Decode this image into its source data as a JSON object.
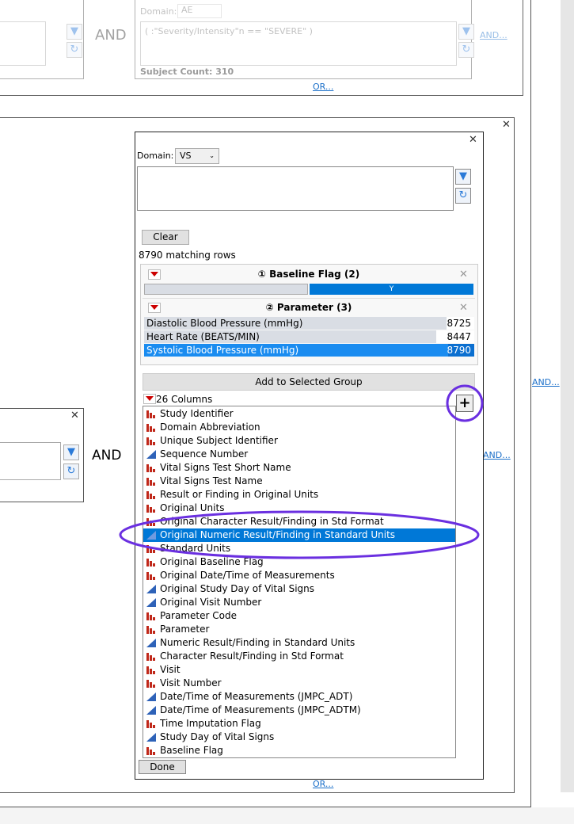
{
  "top_group": {
    "and_label": "AND",
    "domain_label": "Domain:",
    "domain_value": "AE",
    "expression": "( :\"Severity/Intensity\"n == \"SEVERE\" )",
    "subject_count": "Subject Count: 310",
    "and_link": "AND...",
    "or_link": "OR..."
  },
  "left_group": {
    "and_label": "AND"
  },
  "panel": {
    "domain_label": "Domain:",
    "domain_value": "VS",
    "expression": "",
    "clear_label": "Clear",
    "matching_rows": "8790 matching rows",
    "filters": [
      {
        "title": "① Baseline Flag (2)",
        "levels": [
          {
            "label": "",
            "selected": false
          },
          {
            "label": "Y",
            "selected": true
          }
        ]
      },
      {
        "title": "② Parameter (3)",
        "levels": [
          {
            "label": "Diastolic Blood Pressure (mmHg)",
            "count": "8725",
            "selected": false
          },
          {
            "label": "Heart Rate (BEATS/MIN)",
            "count": "8447",
            "selected": false
          },
          {
            "label": "Systolic Blood Pressure (mmHg)",
            "count": "8790",
            "selected": true
          }
        ]
      }
    ],
    "add_group_label": "Add to Selected Group",
    "columns_label": "26 Columns",
    "add_button": "+",
    "columns": [
      {
        "name": "Study Identifier",
        "type": "nominal"
      },
      {
        "name": "Domain Abbreviation",
        "type": "nominal"
      },
      {
        "name": "Unique Subject Identifier",
        "type": "nominal"
      },
      {
        "name": "Sequence Number",
        "type": "continuous"
      },
      {
        "name": "Vital Signs Test Short Name",
        "type": "nominal"
      },
      {
        "name": "Vital Signs Test Name",
        "type": "nominal"
      },
      {
        "name": "Result or Finding in Original Units",
        "type": "nominal"
      },
      {
        "name": "Original Units",
        "type": "nominal"
      },
      {
        "name": "Original Character Result/Finding in Std Format",
        "type": "nominal"
      },
      {
        "name": "Original Numeric Result/Finding in Standard Units",
        "type": "continuous",
        "selected": true
      },
      {
        "name": "Standard Units",
        "type": "nominal"
      },
      {
        "name": "Original Baseline Flag",
        "type": "nominal"
      },
      {
        "name": "Original Date/Time of Measurements",
        "type": "nominal"
      },
      {
        "name": "Original Study Day of Vital Signs",
        "type": "continuous"
      },
      {
        "name": "Original Visit Number",
        "type": "continuous"
      },
      {
        "name": "Parameter Code",
        "type": "nominal"
      },
      {
        "name": "Parameter",
        "type": "nominal"
      },
      {
        "name": "Numeric Result/Finding in Standard Units",
        "type": "continuous"
      },
      {
        "name": "Character Result/Finding in Std Format",
        "type": "nominal"
      },
      {
        "name": "Visit",
        "type": "nominal"
      },
      {
        "name": "Visit Number",
        "type": "nominal"
      },
      {
        "name": "Date/Time of Measurements (JMPC_ADT)",
        "type": "continuous"
      },
      {
        "name": "Date/Time of Measurements (JMPC_ADTM)",
        "type": "continuous"
      },
      {
        "name": "Time Imputation Flag",
        "type": "nominal"
      },
      {
        "name": "Study Day of Vital Signs",
        "type": "continuous"
      },
      {
        "name": "Baseline Flag",
        "type": "nominal"
      }
    ],
    "done_label": "Done"
  },
  "middle_and_link": "AND...",
  "right_and_link": "AND...",
  "bottom_or_link": "OR...",
  "colors": {
    "selection": "#0078d7",
    "highlight": "#6a2fe0",
    "link": "#1a6fc9"
  }
}
